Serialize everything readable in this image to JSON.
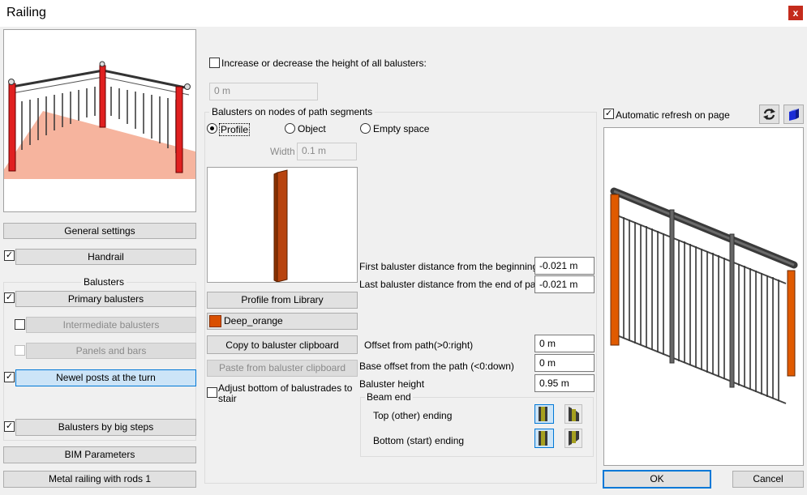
{
  "window": {
    "title": "Railing",
    "close_glyph": "x"
  },
  "left_panel": {
    "general_settings": "General settings",
    "handrail": "Handrail",
    "balusters_header": "Balusters",
    "primary_balusters": "Primary balusters",
    "intermediate_balusters": "Intermediate balusters",
    "panels_and_bars": "Panels and bars",
    "newel_posts": "Newel posts at the turn",
    "balusters_big_steps": "Balusters by big steps",
    "bim_parameters": "BIM Parameters",
    "preset": "Metal railing with rods 1",
    "checkbox_glyph": "✓"
  },
  "middle": {
    "increase_height_label": "Increase or decrease the height of all balusters:",
    "increase_height_value": "0 m",
    "group_title": "Balusters on nodes of path segments",
    "radio_profile": "Profile",
    "radio_object": "Object",
    "radio_empty": "Empty space",
    "width_label": "Width",
    "width_value": "0.1 m",
    "profile_from_library": "Profile from Library",
    "material_name": "Deep_orange",
    "copy_clipboard": "Copy to baluster clipboard",
    "paste_clipboard": "Paste from baluster clipboard",
    "adjust_bottom": "Adjust bottom of balustrades to stair",
    "first_distance_label": "First baluster distance from the beginning",
    "first_distance_value": "-0.021 m",
    "last_distance_label": "Last baluster distance from the end of path",
    "last_distance_value": "-0.021 m",
    "offset_label": "Offset from path(>0:right)",
    "offset_value": "0 m",
    "base_offset_label": "Base offset from the path (<0:down)",
    "base_offset_value": "0 m",
    "height_label": "Baluster height",
    "height_value": "0.95 m",
    "beam_end_title": "Beam end",
    "top_ending": "Top (other) ending",
    "bottom_ending": "Bottom (start) ending"
  },
  "right_panel": {
    "auto_refresh": "Automatic refresh on page",
    "ok": "OK",
    "cancel": "Cancel"
  },
  "colors": {
    "accent": "#0078d7",
    "post": "#d94f00",
    "material": "#d94f00"
  }
}
